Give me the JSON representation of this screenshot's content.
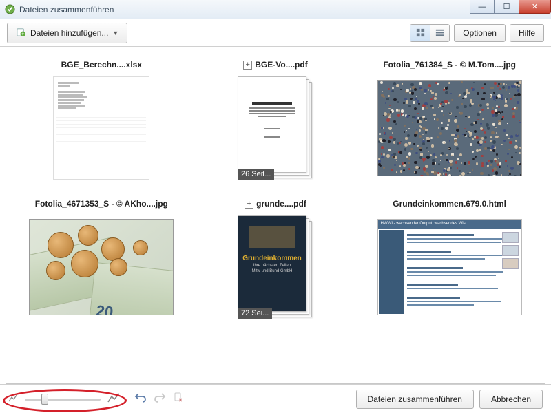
{
  "window": {
    "title": "Dateien zusammenführen"
  },
  "toolbar": {
    "add_files_label": "Dateien hinzufügen...",
    "options_label": "Optionen",
    "help_label": "Hilfe"
  },
  "files": [
    {
      "name": "BGE_Berechn....xlsx",
      "type": "xlsx"
    },
    {
      "name": "BGE-Vo....pdf",
      "type": "pdf",
      "pages_badge": "26 Seit...",
      "expandable": true
    },
    {
      "name": "Fotolia_761384_S - © M.Tom....jpg",
      "type": "image_crowd"
    },
    {
      "name": "Fotolia_4671353_S - © AKho....jpg",
      "type": "image_coins"
    },
    {
      "name": "grunde....pdf",
      "type": "pdf_dark",
      "pages_badge": "72 Sei...",
      "expandable": true,
      "cover_title": "Grundeinkommen"
    },
    {
      "name": "Grundeinkommen.679.0.html",
      "type": "html",
      "banner": "HWWI - wachsender Output, wachsendes Wis"
    }
  ],
  "coins_note_value": "20",
  "footer": {
    "merge_label": "Dateien zusammenführen",
    "cancel_label": "Abbrechen"
  }
}
